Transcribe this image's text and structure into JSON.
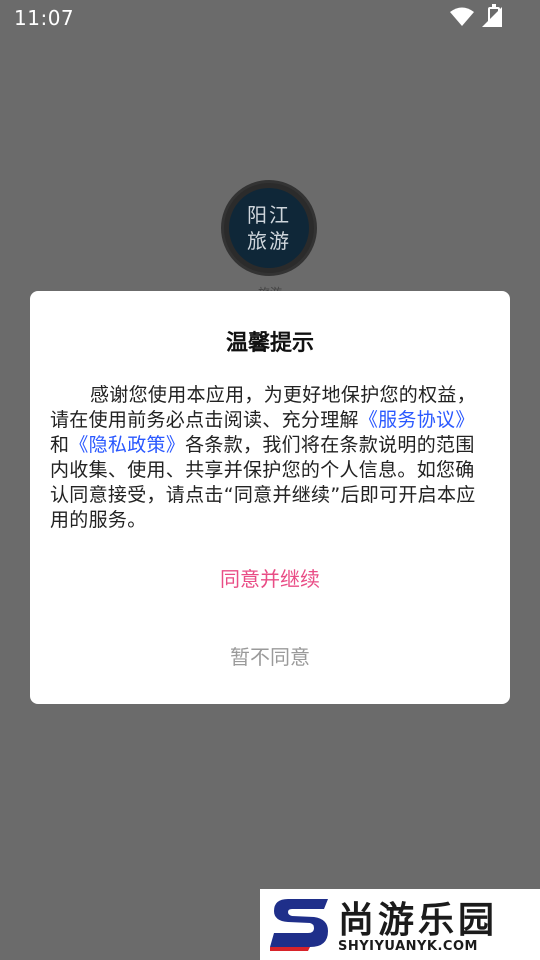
{
  "status_bar": {
    "time": "11:07",
    "icons": [
      "wifi-icon",
      "signal-icon",
      "battery-charging-icon"
    ]
  },
  "splash": {
    "logo_text_line1": "阳江",
    "logo_text_line2": "旅游",
    "caption": "旅游"
  },
  "dialog": {
    "title": "温馨提示",
    "body_part1": "感谢您使用本应用，为更好地保护您的权益，请在使用前务必点击阅读、充分理解",
    "link_service": "《服务协议》",
    "body_part2": "和",
    "link_privacy": "《隐私政策》",
    "body_part3": "各条款，我们将在条款说明的范围内收集、使用、共享并保护您的个人信息。如您确认同意接受，请点击“同意并继续”后即可开启本应用的服务。",
    "agree_label": "同意并继续",
    "decline_label": "暂不同意"
  },
  "watermark": {
    "name": "尚游乐园",
    "url": "SHYIYUANYK.COM"
  },
  "colors": {
    "overlay": "#6b6b6b",
    "link": "#2a58ff",
    "agree": "#e94d86",
    "decline": "#9a9a9a"
  }
}
